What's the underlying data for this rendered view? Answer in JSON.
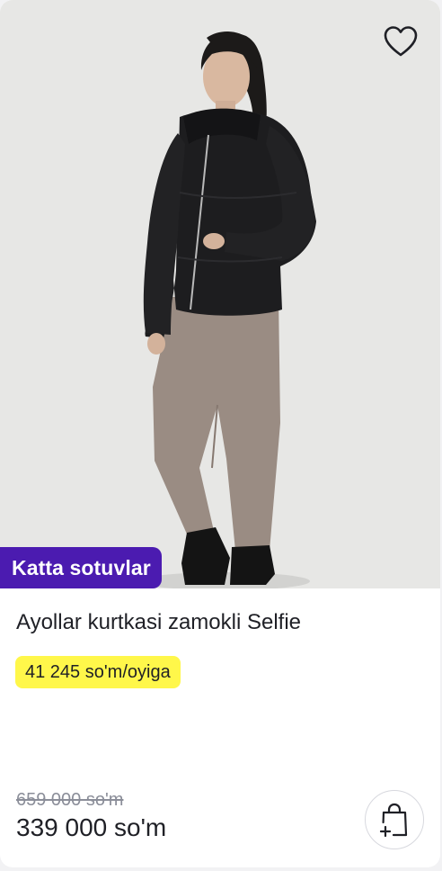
{
  "product": {
    "badge": "Katta sotuvlar",
    "title": "Ayollar kurtkasi zamokli Selfie",
    "installment": "41 245 so'm/oyiga",
    "old_price": "659 000 so'm",
    "price": "339 000 so'm"
  },
  "icons": {
    "favorite": "heart-icon",
    "add_to_cart": "shopping-bag-plus-icon"
  },
  "colors": {
    "badge_bg": "#4b1bb0",
    "installment_bg": "#fff74a",
    "text": "#1f2026",
    "muted": "#8b8e99"
  }
}
